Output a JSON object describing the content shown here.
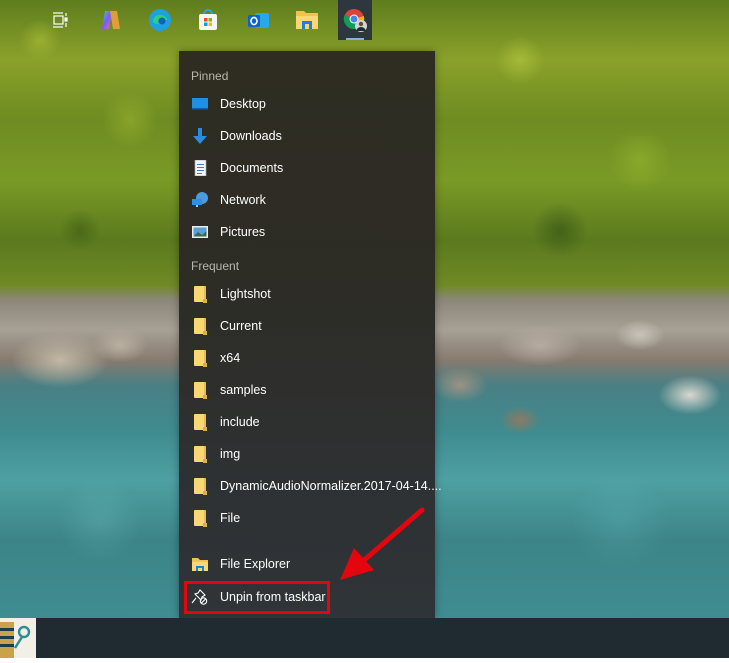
{
  "jumplist": {
    "pinned_header": "Pinned",
    "pinned": [
      {
        "label": "Desktop",
        "icon": "desktop-icon"
      },
      {
        "label": "Downloads",
        "icon": "download-arrow-icon"
      },
      {
        "label": "Documents",
        "icon": "document-icon"
      },
      {
        "label": "Network",
        "icon": "network-icon"
      },
      {
        "label": "Pictures",
        "icon": "pictures-icon"
      }
    ],
    "frequent_header": "Frequent",
    "frequent": [
      {
        "label": "Lightshot",
        "icon": "folder-icon"
      },
      {
        "label": "Current",
        "icon": "folder-icon"
      },
      {
        "label": "x64",
        "icon": "folder-icon"
      },
      {
        "label": "samples",
        "icon": "folder-icon"
      },
      {
        "label": "include",
        "icon": "folder-icon"
      },
      {
        "label": "img",
        "icon": "folder-icon"
      },
      {
        "label": "DynamicAudioNormalizer.2017-04-14....",
        "icon": "folder-icon"
      },
      {
        "label": "File",
        "icon": "folder-icon"
      }
    ],
    "actions": [
      {
        "label": "File Explorer",
        "icon": "file-explorer-icon"
      },
      {
        "label": "Unpin from taskbar",
        "icon": "unpin-icon"
      }
    ]
  },
  "annotation": {
    "highlight_color": "#e4060e",
    "highlighted_item": "Unpin from taskbar"
  },
  "taskbar": {
    "apps": [
      {
        "name": "Task View",
        "icon": "task-view-icon"
      },
      {
        "name": "Copilot",
        "icon": "copilot-icon"
      },
      {
        "name": "Microsoft Edge",
        "icon": "edge-icon"
      },
      {
        "name": "Microsoft Store",
        "icon": "store-icon"
      },
      {
        "name": "Outlook",
        "icon": "outlook-icon"
      },
      {
        "name": "File Explorer",
        "icon": "file-explorer-icon"
      },
      {
        "name": "Google Chrome",
        "icon": "chrome-icon",
        "active": true
      }
    ]
  }
}
